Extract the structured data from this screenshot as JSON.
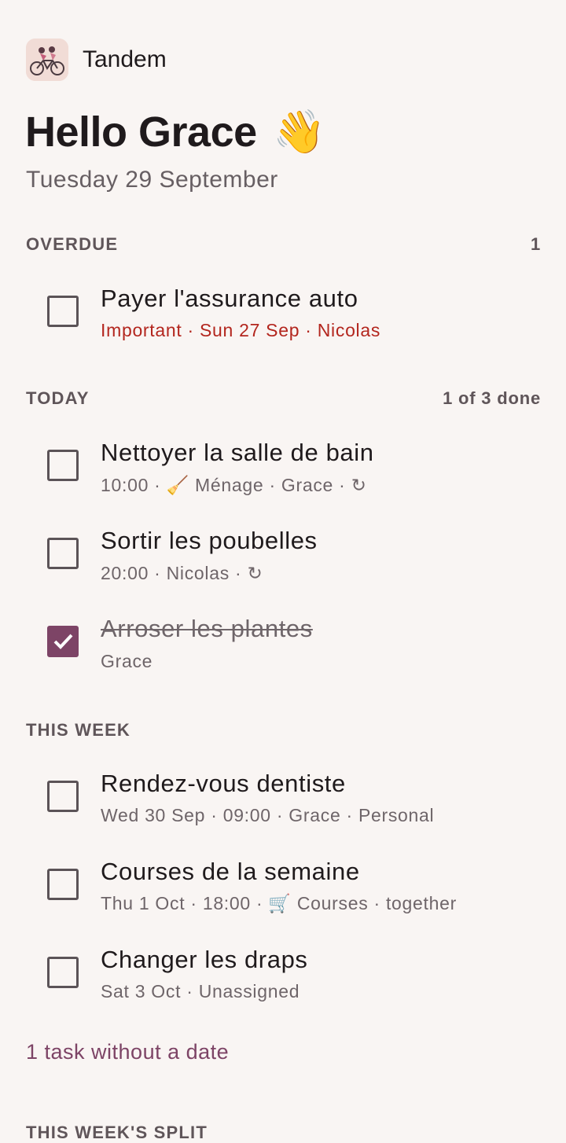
{
  "app": {
    "name": "Tandem",
    "logo_icon": "tandem-bicycle-logo"
  },
  "greeting": {
    "text": "Hello Grace",
    "emoji": "👋"
  },
  "date_line": "Tuesday 29 September",
  "accent_color": "#7d4466",
  "overdue_color": "#b3261e",
  "sections": {
    "overdue": {
      "title": "OVERDUE",
      "count": "1",
      "tasks": [
        {
          "title": "Payer l'assurance auto",
          "meta": "Important · Sun 27 Sep · Nicolas",
          "done": false
        }
      ]
    },
    "today": {
      "title": "TODAY",
      "count": "1 of 3 done",
      "tasks": [
        {
          "title": "Nettoyer la salle de bain",
          "meta_before": "10:00 · ",
          "category_icon": "🧹",
          "meta_after": " Ménage · Grace · ",
          "repeat_icon": "↻",
          "done": false
        },
        {
          "title": "Sortir les poubelles",
          "meta_before": "20:00 · Nicolas · ",
          "repeat_icon": "↻",
          "done": false
        },
        {
          "title": "Arroser les plantes",
          "meta": "Grace",
          "done": true
        }
      ]
    },
    "this_week": {
      "title": "THIS WEEK",
      "tasks": [
        {
          "title": "Rendez-vous dentiste",
          "meta": "Wed 30 Sep · 09:00 · Grace · Personal",
          "done": false
        },
        {
          "title": "Courses de la semaine",
          "meta_before": "Thu 1 Oct · 18:00 · ",
          "category_icon": "🛒",
          "meta_after": " Courses · together",
          "done": false
        },
        {
          "title": "Changer les draps",
          "meta": "Sat 3 Oct · Unassigned",
          "done": false
        }
      ]
    }
  },
  "undated_link": "1 task without a date",
  "split_section_title": "THIS WEEK'S SPLIT"
}
